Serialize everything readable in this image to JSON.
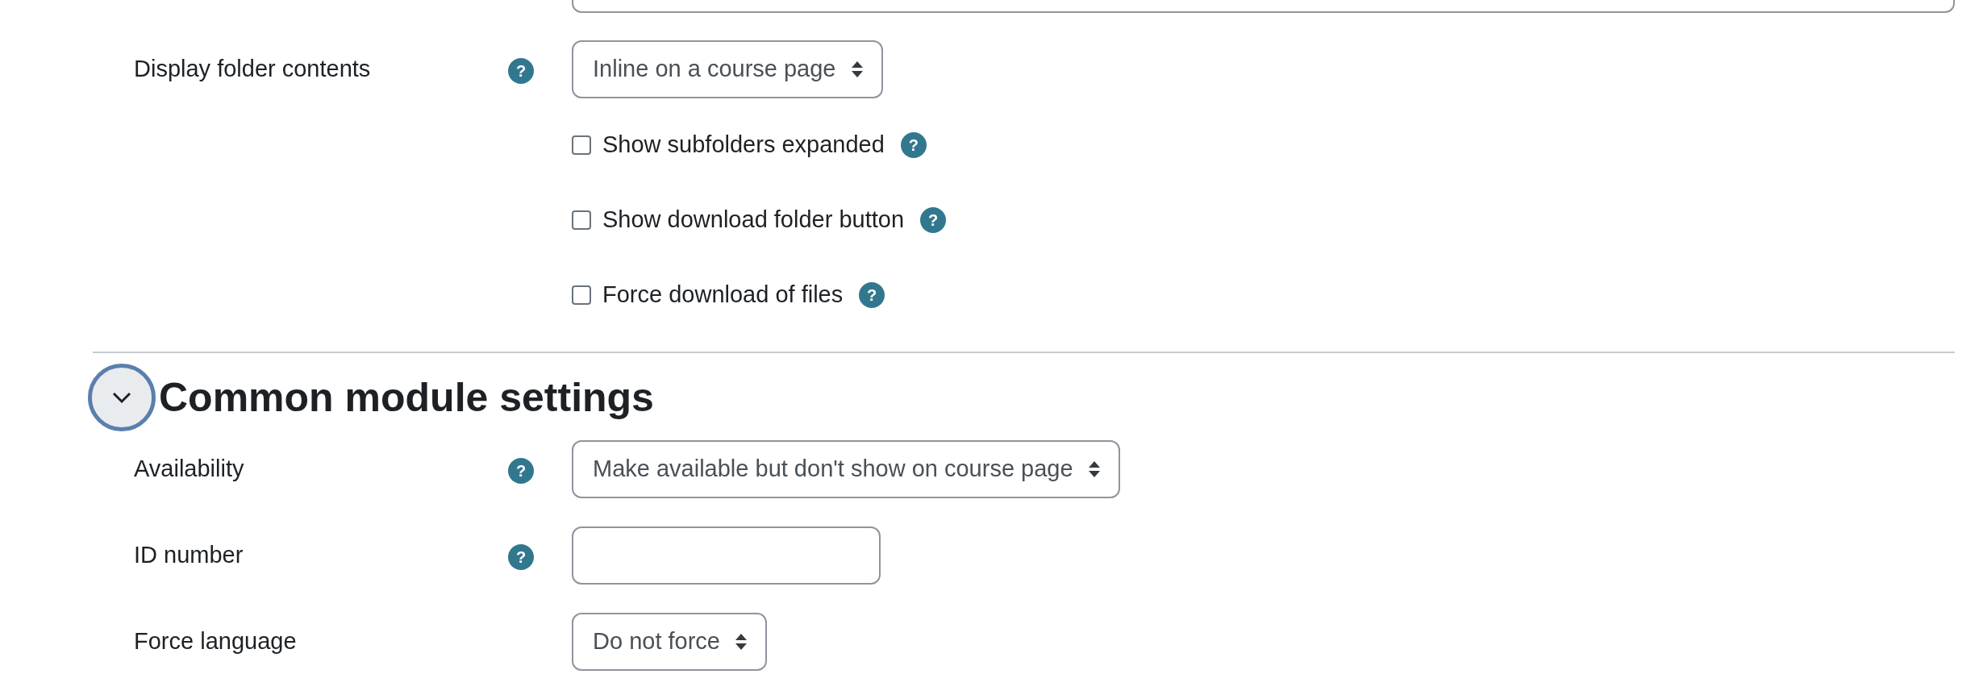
{
  "fields_above": [
    {
      "kind": "input"
    }
  ],
  "folder_settings": {
    "display": {
      "label": "Display folder contents",
      "help": "?",
      "value": "Inline on a course page"
    },
    "checkboxes": [
      {
        "label": "Show subfolders expanded",
        "checked": false,
        "help": "?"
      },
      {
        "label": "Show download folder button",
        "checked": false,
        "help": "?"
      },
      {
        "label": "Force download of files",
        "checked": false,
        "help": "?"
      }
    ]
  },
  "section": {
    "title": "Common module settings",
    "expanded": true,
    "fields": [
      {
        "kind": "select",
        "label": "Availability",
        "help": "?",
        "value": "Make available but don't show on course page"
      },
      {
        "kind": "input",
        "label": "ID number",
        "help": "?"
      },
      {
        "kind": "select",
        "label": "Force language",
        "value": "Do not force"
      }
    ]
  }
}
